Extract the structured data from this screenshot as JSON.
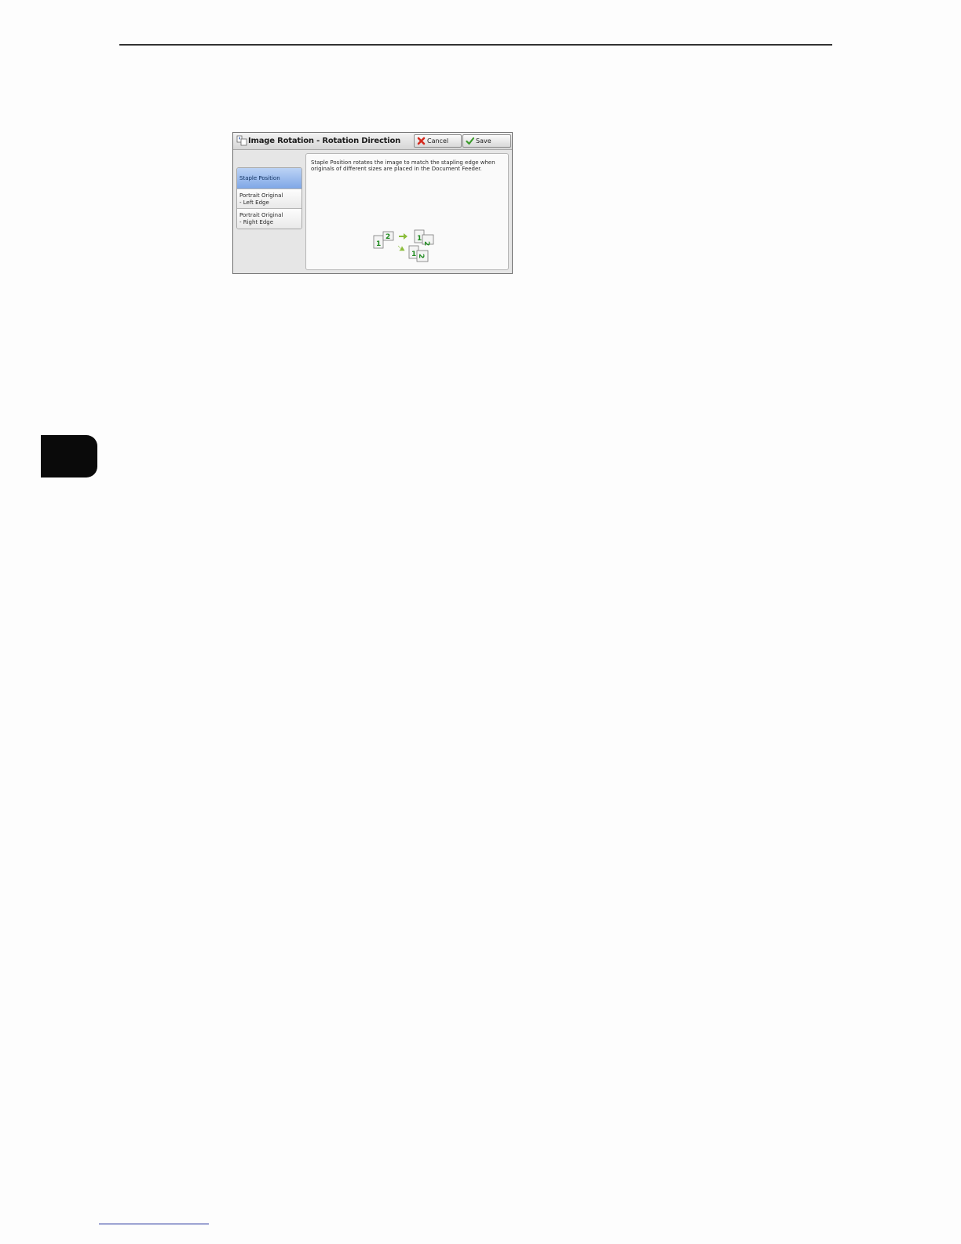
{
  "dialog": {
    "title": "Image Rotation - Rotation Direction",
    "cancel_label": "Cancel",
    "save_label": "Save",
    "options": [
      {
        "label": "Staple Position",
        "selected": true
      },
      {
        "label": "Portrait Original\n- Left Edge",
        "selected": false
      },
      {
        "label": "Portrait Original\n- Right Edge",
        "selected": false
      }
    ],
    "description": "Staple Position rotates the image to match the stapling edge when originals of different sizes are placed in the Document Feeder.",
    "illustration": {
      "page_numbers": [
        "1",
        "2",
        "1",
        "2",
        "1",
        "2"
      ]
    }
  },
  "colors": {
    "selected_option": "#7fa7e6",
    "page_number_green": "#1f8a1f",
    "cancel_icon_red": "#d42a1e",
    "save_icon_green": "#3c9a2c"
  },
  "icons": {
    "title": "rotation-direction-icon",
    "cancel": "red-x-icon",
    "save": "green-check-icon"
  }
}
